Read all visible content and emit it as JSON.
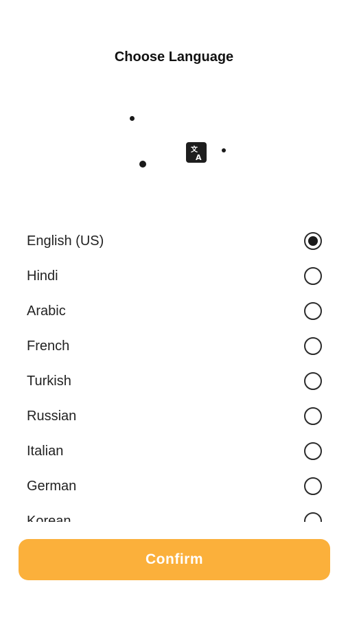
{
  "header": {
    "title": "Choose Language"
  },
  "illustration": {
    "icon": "translate-icon"
  },
  "languages": {
    "items": [
      {
        "label": "English (US)",
        "selected": true
      },
      {
        "label": "Hindi",
        "selected": false
      },
      {
        "label": "Arabic",
        "selected": false
      },
      {
        "label": "French",
        "selected": false
      },
      {
        "label": "Turkish",
        "selected": false
      },
      {
        "label": "Russian",
        "selected": false
      },
      {
        "label": "Italian",
        "selected": false
      },
      {
        "label": "German",
        "selected": false
      },
      {
        "label": "Korean",
        "selected": false
      }
    ]
  },
  "footer": {
    "confirm_label": "Confirm"
  },
  "colors": {
    "accent": "#FBB03B",
    "text": "#222222",
    "background": "#FFFFFF"
  }
}
